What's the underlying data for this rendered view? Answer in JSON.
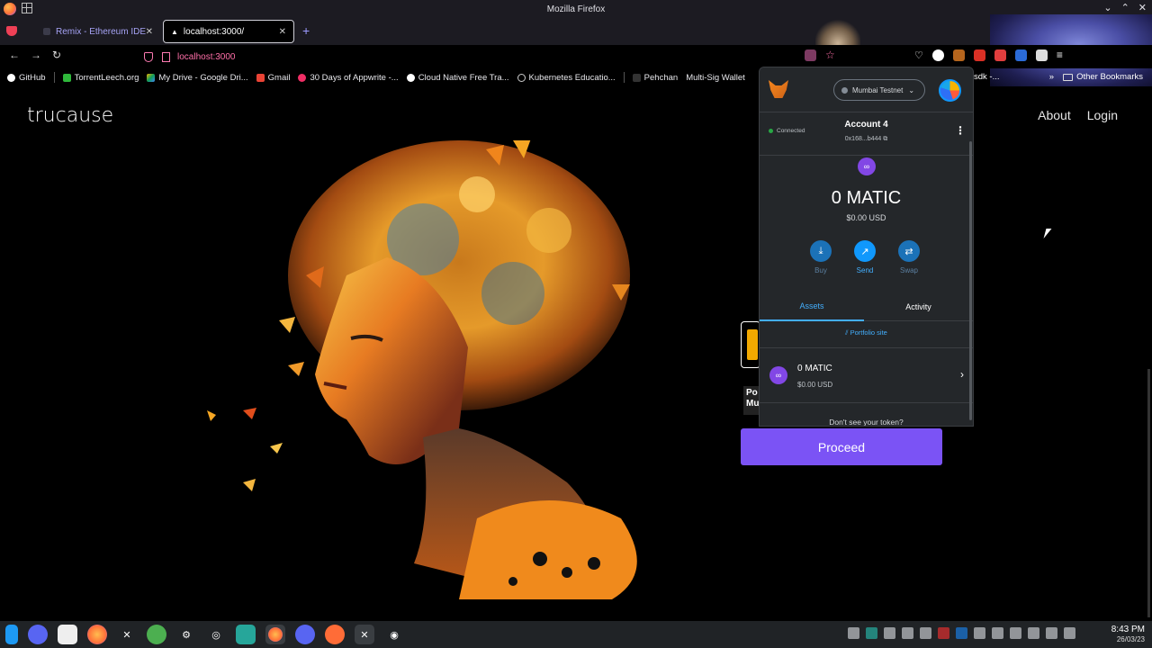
{
  "window": {
    "title": "Mozilla Firefox"
  },
  "tabs": [
    {
      "label": "Remix - Ethereum IDE"
    },
    {
      "label": "localhost:3000/"
    }
  ],
  "url": "localhost:3000",
  "bookmarks": [
    {
      "label": "GitHub",
      "color": "#ffffff"
    },
    {
      "label": "TorrentLeech.org",
      "color": "#2fb83b"
    },
    {
      "label": "My Drive - Google Dri...",
      "color": "#f4b400"
    },
    {
      "label": "Gmail",
      "color": "#ea4335"
    },
    {
      "label": "30 Days of Appwrite -...",
      "color": "#f02e65"
    },
    {
      "label": "Cloud Native Free Tra...",
      "color": "#ffffff"
    },
    {
      "label": "Kubernetes Educatio...",
      "color": "#cccccc"
    },
    {
      "label": "Pehchan",
      "color": "#888888"
    },
    {
      "label": "Multi-Sig Wallet",
      "color": "#444444"
    },
    {
      "label": "sdk -...",
      "color": "#555555"
    }
  ],
  "other_bookmarks": "Other Bookmarks",
  "site": {
    "brand": "trucause",
    "nav": [
      "About",
      "Login"
    ],
    "proceed": "Proceed",
    "partial_text": "Po Mu"
  },
  "metamask": {
    "network": "Mumbai Testnet",
    "connected": "Connected",
    "account_name": "Account 4",
    "address": "0x168...b444",
    "balance": "0 MATIC",
    "balance_usd": "$0.00 USD",
    "actions": [
      {
        "label": "Buy",
        "color": "#1b72b8",
        "text_color": "#5b7fa0"
      },
      {
        "label": "Send",
        "color": "#1098fc",
        "text_color": "#43aefc"
      },
      {
        "label": "Swap",
        "color": "#1b72b8",
        "text_color": "#5b7fa0"
      }
    ],
    "tab_assets": "Assets",
    "tab_activity": "Activity",
    "portfolio": "Portfolio site",
    "asset_amount": "0 MATIC",
    "asset_usd": "$0.00 USD",
    "dont_see": "Don't see your token?"
  },
  "taskbar": {
    "time": "8:43 PM",
    "date": "26/03/23"
  },
  "colors": {
    "accent": "#7b53f5",
    "metamask_blue": "#43aefc",
    "matic": "#8247e5"
  }
}
